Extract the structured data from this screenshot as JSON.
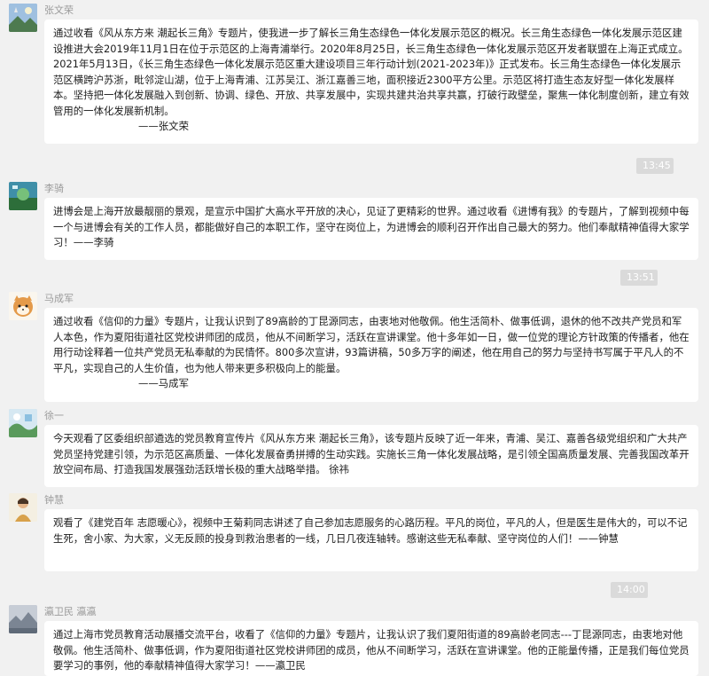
{
  "messages": [
    {
      "sender": "张文荣",
      "text": "通过收看《风从东方来 潮起长三角》专题片，使我进一步了解长三角生态绿色一体化发展示范区的概况。长三角生态绿色一体化发展示范区建设推进大会2019年11月1日在位于示范区的上海青浦举行。2020年8月25日，长三角生态绿色一体化发展示范区开发者联盟在上海正式成立。2021年5月13日，《长三角生态绿色一体化发展示范区重大建设项目三年行动计划(2021-2023年)》正式发布。长三角生态绿色一体化发展示范区横跨沪苏浙，毗邻淀山湖，位于上海青浦、江苏吴江、浙江嘉善三地，面积接近2300平方公里。示范区将打造生态友好型一体化发展样本。坚持把一体化发展融入到创新、协调、绿色、开放、共享发展中，实现共建共治共享共赢，打破行政壁垒，聚焦一体化制度创新，建立有效管用的一体化发展新机制。",
      "signature": "——张文荣"
    },
    {
      "sender": "李骑",
      "text": "进博会是上海开放最靓丽的景观，是宣示中国扩大高水平开放的决心，见证了更精彩的世界。通过收看《进博有我》的专题片，了解到视频中每一个与进博会有关的工作人员，都能做好自己的本职工作，坚守在岗位上，为进博会的顺利召开作出自己最大的努力。他们奉献精神值得大家学习！——李骑",
      "signature": ""
    },
    {
      "sender": "马成军",
      "text": "通过收看《信仰的力量》专题片，让我认识到了89高龄的丁昆源同志，由衷地对他敬佩。他生活简朴、做事低调，退休的他不改共产党员和军人本色，作为夏阳街道社区党校讲师团的成员，他从不间断学习，活跃在宣讲课堂。他十多年如一日，做一位党的理论方针政策的传播者，他在用行动诠释着一位共产党员无私奉献的为民情怀。800多次宣讲，93篇讲稿，50多万字的阐述，他在用自己的努力与坚持书写属于平凡人的不平凡，实现自己的人生价值，也为他人带来更多积极向上的能量。",
      "signature": "——马成军"
    },
    {
      "sender": "徐一",
      "text": "今天观看了区委组织部遴选的党员教育宣传片《风从东方来 潮起长三角》，该专题片反映了近一年来，青浦、吴江、嘉善各级党组织和广大共产党员坚持党建引领，为示范区高质量、一体化发展奋勇拼搏的生动实践。实施长三角一体化发展战略，是引领全国高质量发展、完善我国改革开放空间布局、打造我国发展强劲活跃增长极的重大战略举措。        徐祎",
      "signature": ""
    },
    {
      "sender": "钟慧",
      "text": "观看了《建党百年 志愿暖心》，视频中王菊莉同志讲述了自己参加志愿服务的心路历程。平凡的岗位，平凡的人，但是医生是伟大的，可以不记生死，舍小家、为大家，义无反顾的投身到救治患者的一线，几日几夜连轴转。感谢这些无私奉献、坚守岗位的人们！——钟慧",
      "signature": ""
    },
    {
      "sender": "瀛卫民 瀛瀛",
      "text": "通过上海市党员教育活动展播交流平台，收看了《信仰的力量》专题片，让我认识了我们夏阳街道的89高龄老同志---丁昆源同志，由衷地对他敬佩。他生活简朴、做事低调，作为夏阳街道社区党校讲师团的成员，他从不间断学习，活跃在宣讲课堂。他的正能量传播，正是我们每位党员要学习的事例，他的奉献精神值得大家学习！——瀛卫民",
      "signature": ""
    }
  ],
  "timestamps": [
    "13:45",
    "13:51",
    "14:00"
  ]
}
